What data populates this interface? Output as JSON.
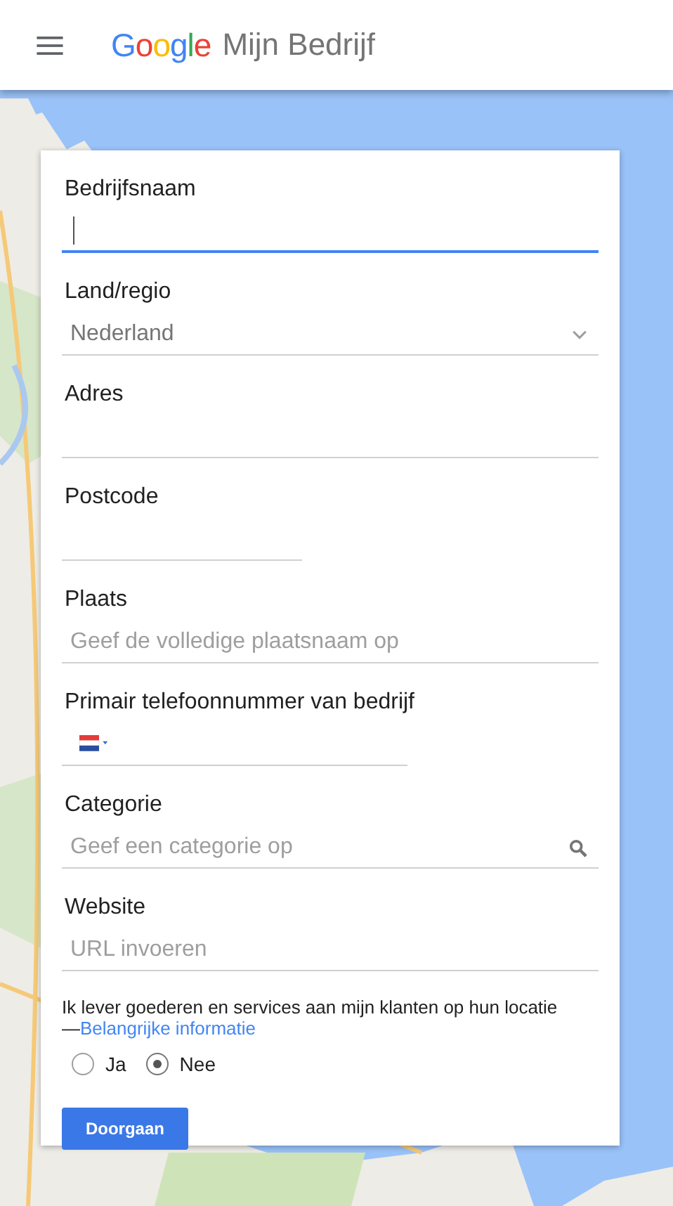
{
  "header": {
    "logo": "Google",
    "product": "Mijn Bedrijf"
  },
  "fields": [
    {
      "label": "Bedrijfsnaam",
      "kind": "text",
      "focused": true
    },
    {
      "label": "Land/regio",
      "kind": "select",
      "value": "Nederland",
      "focused": false
    },
    {
      "label": "Adres",
      "kind": "text",
      "focused": false
    },
    {
      "label": "Postcode",
      "kind": "short",
      "focused": false
    },
    {
      "label": "Plaats",
      "kind": "text",
      "placeholder": "Geef de volledige plaatsnaam op",
      "focused": false
    },
    {
      "label": "Primair telefoonnummer van bedrijf",
      "kind": "phone",
      "focused": false
    },
    {
      "label": "Categorie",
      "kind": "search",
      "placeholder": "Geef een categorie op",
      "focused": false
    },
    {
      "label": "Website",
      "kind": "text",
      "placeholder": "URL invoeren",
      "focused": false
    }
  ],
  "delivery": {
    "question": "Ik lever goederen en services aan mijn klanten op hun locatie",
    "dash": "—",
    "link": "Belangrijke informatie",
    "options": [
      {
        "label": "Ja",
        "selected": false
      },
      {
        "label": "Nee",
        "selected": true
      }
    ]
  },
  "submit": "Doorgaan"
}
